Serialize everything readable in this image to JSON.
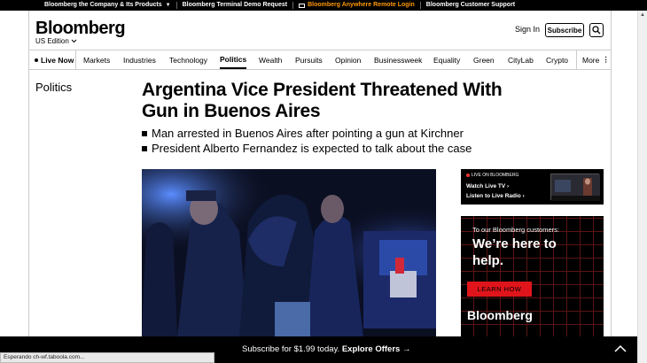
{
  "topbar": {
    "items": [
      "Bloomberg the Company & Its Products",
      "Bloomberg Terminal Demo Request",
      "Bloomberg Anywhere Remote Login",
      "Bloomberg Customer Support"
    ]
  },
  "header": {
    "logo": "Bloomberg",
    "edition": "US Edition",
    "signin": "Sign In",
    "subscribe": "Subscribe"
  },
  "nav": {
    "items": [
      "Live Now",
      "Markets",
      "Industries",
      "Technology",
      "Politics",
      "Wealth",
      "Pursuits",
      "Opinion",
      "Businessweek",
      "Equality",
      "Green",
      "CityLab",
      "Crypto",
      "More"
    ],
    "active": "Politics"
  },
  "article": {
    "section": "Politics",
    "headline": "Argentina Vice President Threatened With Gun in Buenos Aires",
    "bullets": [
      "Man arrested in Buenos Aires after pointing a gun at Kirchner",
      "President Alberto Fernandez is expected to talk about the case"
    ]
  },
  "live_widget": {
    "header": "LIVE ON BLOOMBERG",
    "watch": "Watch Live TV",
    "listen": "Listen to Live Radio"
  },
  "ad": {
    "intro": "To our Bloomberg customers:",
    "headline": "We’re here to help.",
    "button": "LEARN HOW",
    "logo": "Bloomberg"
  },
  "offer_bar": {
    "text": "Subscribe for $1.99 today.",
    "cta": "Explore Offers"
  },
  "status_bar": {
    "text": "Esperando ch-wf.taboola.com..."
  },
  "colors": {
    "accent_orange": "#ff9900",
    "ad_red": "#e0151b",
    "live_red": "#ee3333"
  }
}
